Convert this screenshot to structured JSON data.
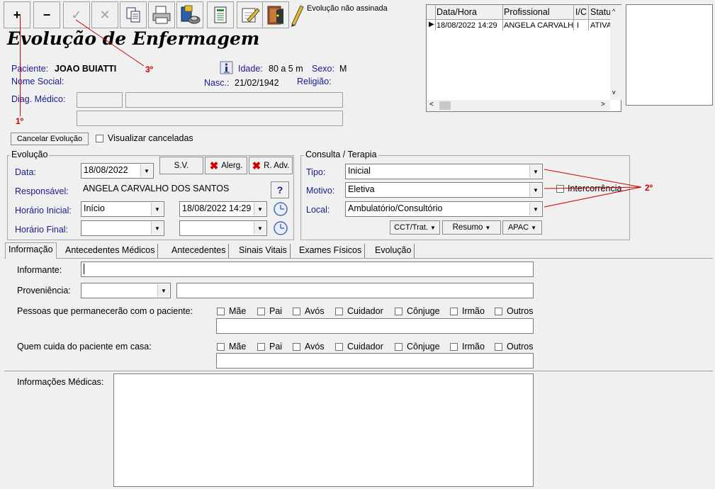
{
  "toolbar": {
    "add_label": "+",
    "remove_label": "−",
    "check_label": "✓",
    "cancel_label": "✕",
    "status_text": "Evolução não assinada"
  },
  "page_title": "Evolução de Enfermagem",
  "patient": {
    "label": "Paciente:",
    "name": "JOAO BUIATTI",
    "age_label": "Idade:",
    "age": "80 a 5 m",
    "sex_label": "Sexo:",
    "sex": "M",
    "social_name_label": "Nome Social:",
    "birth_label": "Nasc.:",
    "birth": "21/02/1942",
    "religion_label": "Religião:",
    "diag_label": "Diag. Médico:"
  },
  "history_table": {
    "headers": [
      "Data/Hora",
      "Profissional",
      "I/C",
      "Statu"
    ],
    "rows": [
      {
        "datetime": "18/08/2022 14:29",
        "professional": "ANGELA CARVALHO",
        "ic": "I",
        "status": "ATIVA"
      }
    ]
  },
  "cancel_button": "Cancelar Evolução",
  "show_cancelled_label": "Visualizar canceladas",
  "evolucao": {
    "legend": "Evolução",
    "date_label": "Data:",
    "date": "18/08/2022",
    "sv_button": "S.V.",
    "alerg_button": "Alerg.",
    "radv_button": "R. Adv.",
    "responsible_label": "Responsável:",
    "responsible": "ANGELA CARVALHO DOS SANTOS",
    "help_label": "?",
    "start_label": "Horário Inicial:",
    "start_value": "Início",
    "start_datetime": "18/08/2022 14:29",
    "end_label": "Horário Final:",
    "end_value": "",
    "end_datetime": ""
  },
  "consulta": {
    "legend": "Consulta / Terapia",
    "tipo_label": "Tipo:",
    "tipo": "Inicial",
    "motivo_label": "Motivo:",
    "motivo": "Eletiva",
    "local_label": "Local:",
    "local": "Ambulatório/Consultório",
    "intercorrencia_label": "Intercorrência",
    "cct_button": "CCT/Trat.",
    "resumo_button": "Resumo",
    "apac_button": "APAC"
  },
  "tabs": [
    "Informação",
    "Antecedentes Médicos",
    "Antecedentes",
    "Sinais Vitais",
    "Exames Físicos",
    "Evolução"
  ],
  "info": {
    "informant_label": "Informante:",
    "informant": "",
    "origin_label": "Proveniência:",
    "people_label": "Pessoas que permanecerão com o paciente:",
    "caregiver_label": "Quem cuida do paciente em casa:",
    "options": [
      "Mãe",
      "Pai",
      "Avós",
      "Cuidador",
      "Cônjuge",
      "Irmão",
      "Outros"
    ],
    "medical_info_label": "Informações Médicas:"
  },
  "annotations": {
    "first": "1º",
    "second": "2º",
    "third": "3º"
  },
  "colors": {
    "label_blue": "#1a1a8c",
    "annotation_red": "#cc0000",
    "window_bg": "#f0f0f0"
  }
}
